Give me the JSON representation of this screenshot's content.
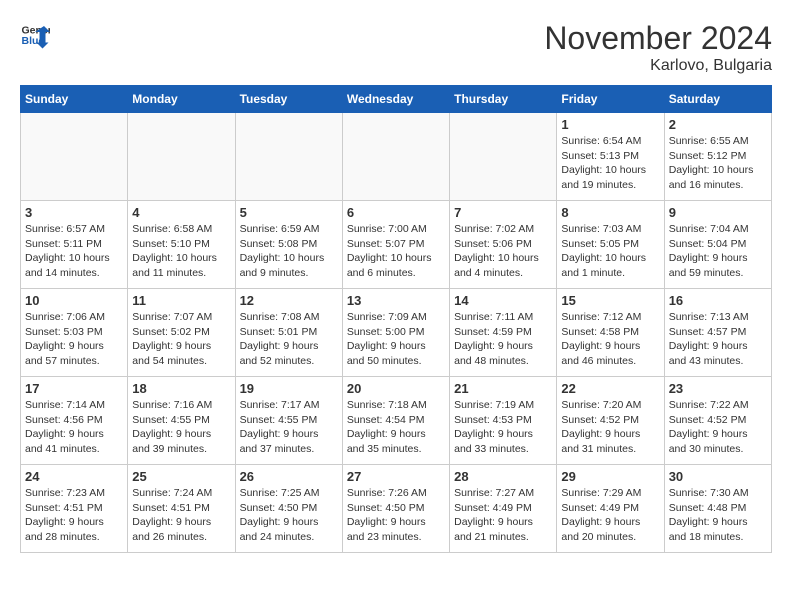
{
  "header": {
    "logo_line1": "General",
    "logo_line2": "Blue",
    "month": "November 2024",
    "location": "Karlovo, Bulgaria"
  },
  "weekdays": [
    "Sunday",
    "Monday",
    "Tuesday",
    "Wednesday",
    "Thursday",
    "Friday",
    "Saturday"
  ],
  "weeks": [
    [
      {
        "day": "",
        "info": ""
      },
      {
        "day": "",
        "info": ""
      },
      {
        "day": "",
        "info": ""
      },
      {
        "day": "",
        "info": ""
      },
      {
        "day": "",
        "info": ""
      },
      {
        "day": "1",
        "info": "Sunrise: 6:54 AM\nSunset: 5:13 PM\nDaylight: 10 hours and 19 minutes."
      },
      {
        "day": "2",
        "info": "Sunrise: 6:55 AM\nSunset: 5:12 PM\nDaylight: 10 hours and 16 minutes."
      }
    ],
    [
      {
        "day": "3",
        "info": "Sunrise: 6:57 AM\nSunset: 5:11 PM\nDaylight: 10 hours and 14 minutes."
      },
      {
        "day": "4",
        "info": "Sunrise: 6:58 AM\nSunset: 5:10 PM\nDaylight: 10 hours and 11 minutes."
      },
      {
        "day": "5",
        "info": "Sunrise: 6:59 AM\nSunset: 5:08 PM\nDaylight: 10 hours and 9 minutes."
      },
      {
        "day": "6",
        "info": "Sunrise: 7:00 AM\nSunset: 5:07 PM\nDaylight: 10 hours and 6 minutes."
      },
      {
        "day": "7",
        "info": "Sunrise: 7:02 AM\nSunset: 5:06 PM\nDaylight: 10 hours and 4 minutes."
      },
      {
        "day": "8",
        "info": "Sunrise: 7:03 AM\nSunset: 5:05 PM\nDaylight: 10 hours and 1 minute."
      },
      {
        "day": "9",
        "info": "Sunrise: 7:04 AM\nSunset: 5:04 PM\nDaylight: 9 hours and 59 minutes."
      }
    ],
    [
      {
        "day": "10",
        "info": "Sunrise: 7:06 AM\nSunset: 5:03 PM\nDaylight: 9 hours and 57 minutes."
      },
      {
        "day": "11",
        "info": "Sunrise: 7:07 AM\nSunset: 5:02 PM\nDaylight: 9 hours and 54 minutes."
      },
      {
        "day": "12",
        "info": "Sunrise: 7:08 AM\nSunset: 5:01 PM\nDaylight: 9 hours and 52 minutes."
      },
      {
        "day": "13",
        "info": "Sunrise: 7:09 AM\nSunset: 5:00 PM\nDaylight: 9 hours and 50 minutes."
      },
      {
        "day": "14",
        "info": "Sunrise: 7:11 AM\nSunset: 4:59 PM\nDaylight: 9 hours and 48 minutes."
      },
      {
        "day": "15",
        "info": "Sunrise: 7:12 AM\nSunset: 4:58 PM\nDaylight: 9 hours and 46 minutes."
      },
      {
        "day": "16",
        "info": "Sunrise: 7:13 AM\nSunset: 4:57 PM\nDaylight: 9 hours and 43 minutes."
      }
    ],
    [
      {
        "day": "17",
        "info": "Sunrise: 7:14 AM\nSunset: 4:56 PM\nDaylight: 9 hours and 41 minutes."
      },
      {
        "day": "18",
        "info": "Sunrise: 7:16 AM\nSunset: 4:55 PM\nDaylight: 9 hours and 39 minutes."
      },
      {
        "day": "19",
        "info": "Sunrise: 7:17 AM\nSunset: 4:55 PM\nDaylight: 9 hours and 37 minutes."
      },
      {
        "day": "20",
        "info": "Sunrise: 7:18 AM\nSunset: 4:54 PM\nDaylight: 9 hours and 35 minutes."
      },
      {
        "day": "21",
        "info": "Sunrise: 7:19 AM\nSunset: 4:53 PM\nDaylight: 9 hours and 33 minutes."
      },
      {
        "day": "22",
        "info": "Sunrise: 7:20 AM\nSunset: 4:52 PM\nDaylight: 9 hours and 31 minutes."
      },
      {
        "day": "23",
        "info": "Sunrise: 7:22 AM\nSunset: 4:52 PM\nDaylight: 9 hours and 30 minutes."
      }
    ],
    [
      {
        "day": "24",
        "info": "Sunrise: 7:23 AM\nSunset: 4:51 PM\nDaylight: 9 hours and 28 minutes."
      },
      {
        "day": "25",
        "info": "Sunrise: 7:24 AM\nSunset: 4:51 PM\nDaylight: 9 hours and 26 minutes."
      },
      {
        "day": "26",
        "info": "Sunrise: 7:25 AM\nSunset: 4:50 PM\nDaylight: 9 hours and 24 minutes."
      },
      {
        "day": "27",
        "info": "Sunrise: 7:26 AM\nSunset: 4:50 PM\nDaylight: 9 hours and 23 minutes."
      },
      {
        "day": "28",
        "info": "Sunrise: 7:27 AM\nSunset: 4:49 PM\nDaylight: 9 hours and 21 minutes."
      },
      {
        "day": "29",
        "info": "Sunrise: 7:29 AM\nSunset: 4:49 PM\nDaylight: 9 hours and 20 minutes."
      },
      {
        "day": "30",
        "info": "Sunrise: 7:30 AM\nSunset: 4:48 PM\nDaylight: 9 hours and 18 minutes."
      }
    ]
  ]
}
